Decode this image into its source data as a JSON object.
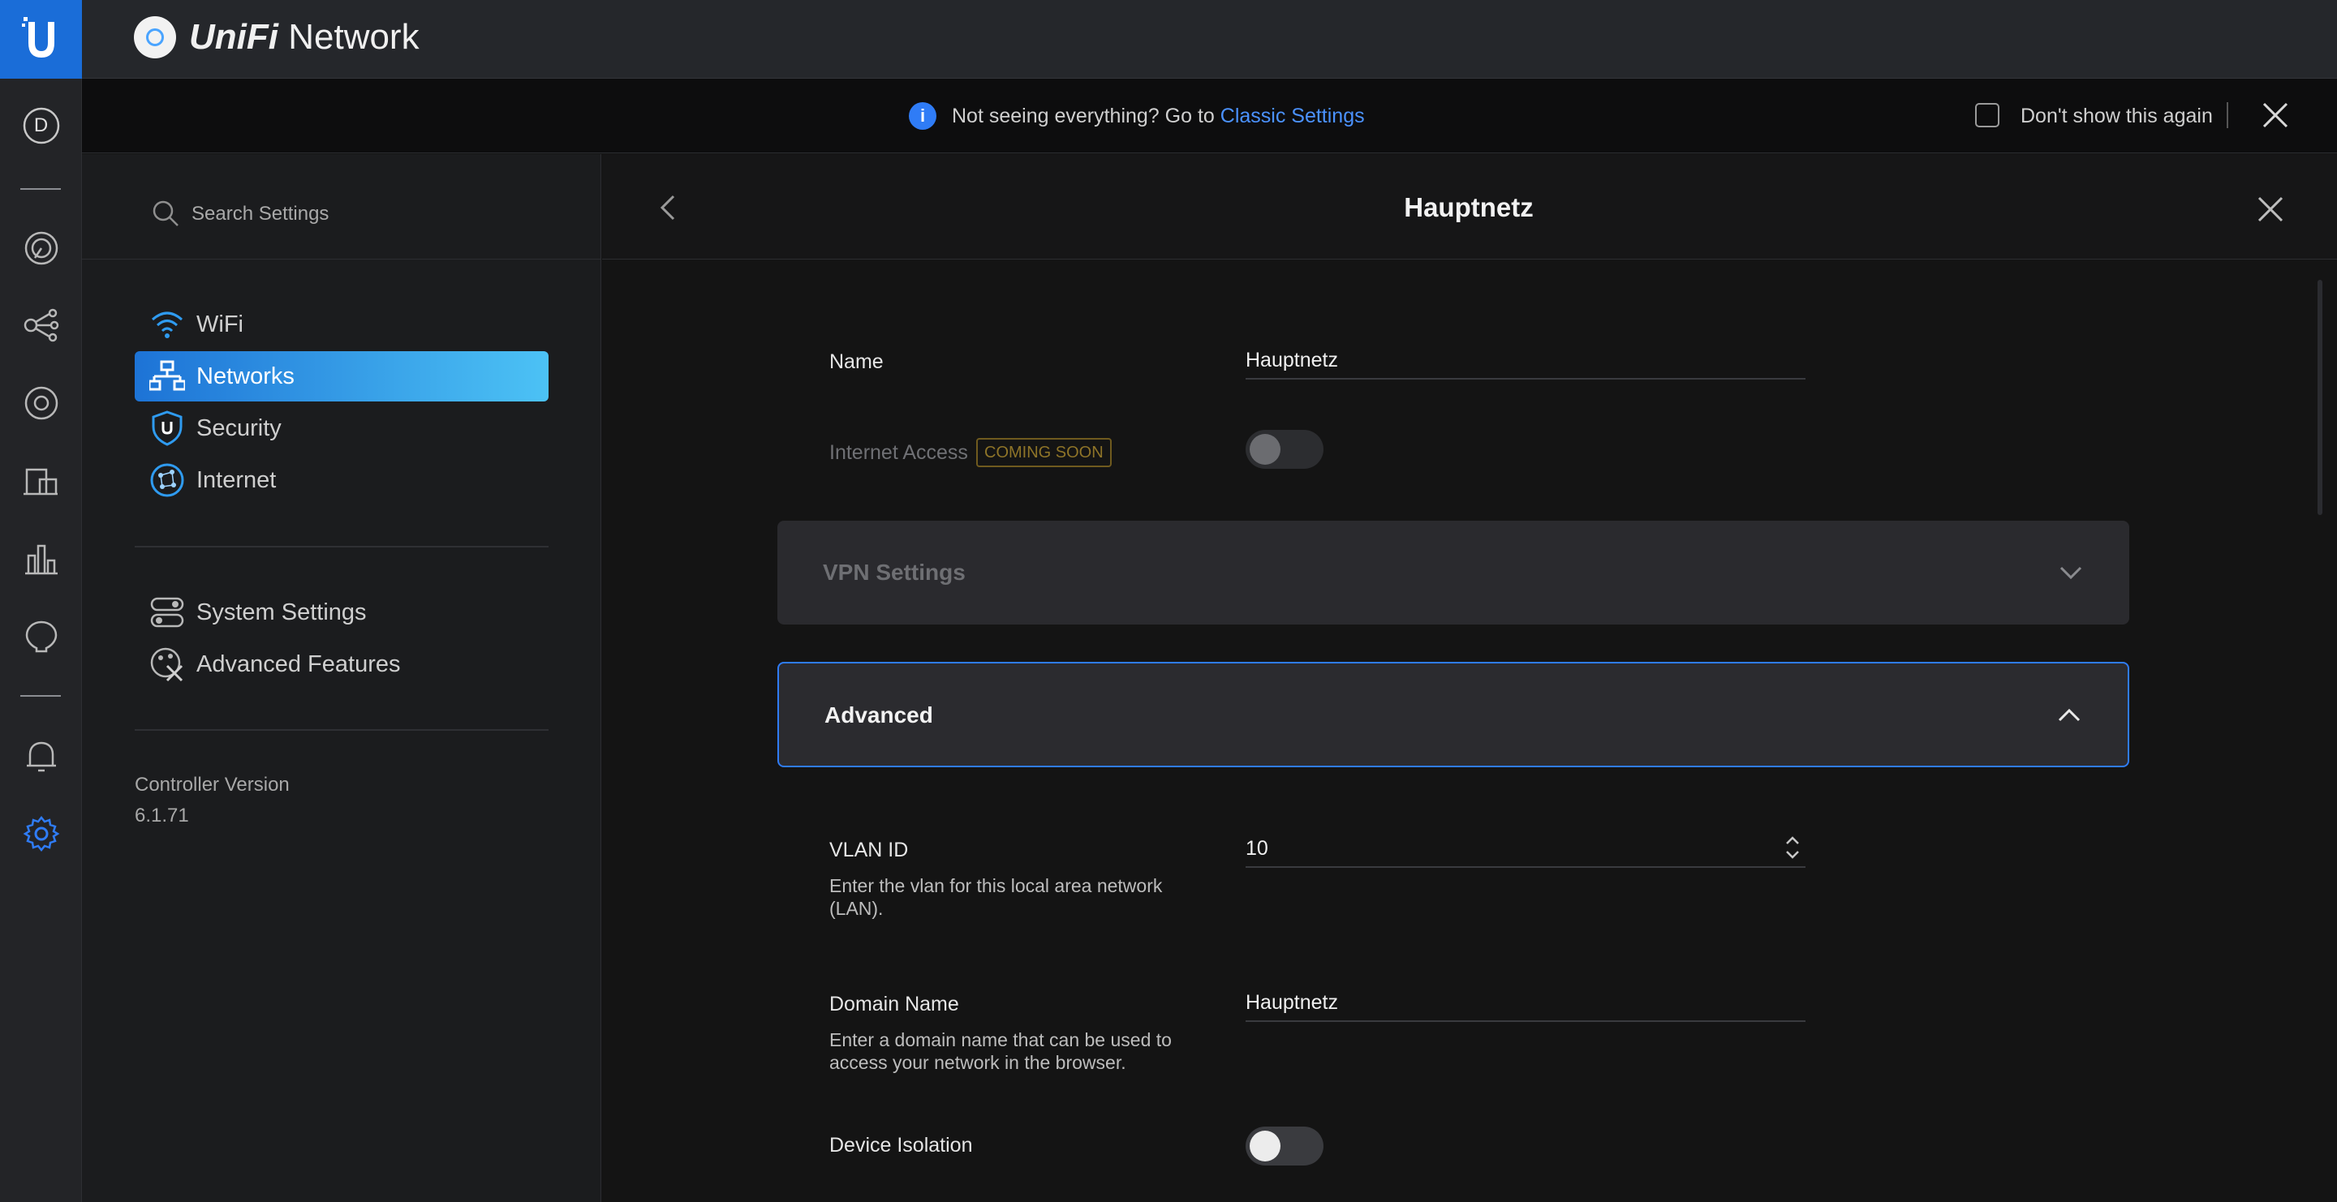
{
  "app": {
    "brand_first": "UniFi",
    "brand_second": "Network"
  },
  "rail": {
    "avatar_letter": "D",
    "items": [
      "dashboard-icon",
      "topology-icon",
      "devices-icon",
      "clients-icon",
      "statistics-icon",
      "insights-icon",
      "notifications-icon",
      "settings-icon"
    ],
    "accent": "#1a6dd8"
  },
  "notice": {
    "text": "Not seeing everything? Go to",
    "link": "Classic Settings",
    "checkbox_label": "Don't show this again"
  },
  "sidebar": {
    "search_placeholder": "Search Settings",
    "items": [
      {
        "label": "WiFi",
        "icon": "wifi-icon"
      },
      {
        "label": "Networks",
        "icon": "networks-icon",
        "active": true
      },
      {
        "label": "Security",
        "icon": "shield-icon"
      },
      {
        "label": "Internet",
        "icon": "globe-icon"
      }
    ],
    "secondary_items": [
      {
        "label": "System Settings",
        "icon": "toggles-icon"
      },
      {
        "label": "Advanced Features",
        "icon": "tools-icon"
      }
    ],
    "version_label": "Controller Version",
    "version_value": "6.1.71"
  },
  "main": {
    "title": "Hauptnetz",
    "name_label": "Name",
    "name_value": "Hauptnetz",
    "internet_access_label": "Internet Access",
    "coming_soon_badge": "COMING SOON",
    "vpn_section": "VPN Settings",
    "advanced_section": "Advanced",
    "vlan_label": "VLAN ID",
    "vlan_desc": "Enter the vlan for this local area network (LAN).",
    "vlan_value": "10",
    "domain_label": "Domain Name",
    "domain_desc": "Enter a domain name that can be used to access your network in the browser.",
    "domain_value": "Hauptnetz",
    "isolation_label": "Device Isolation"
  }
}
